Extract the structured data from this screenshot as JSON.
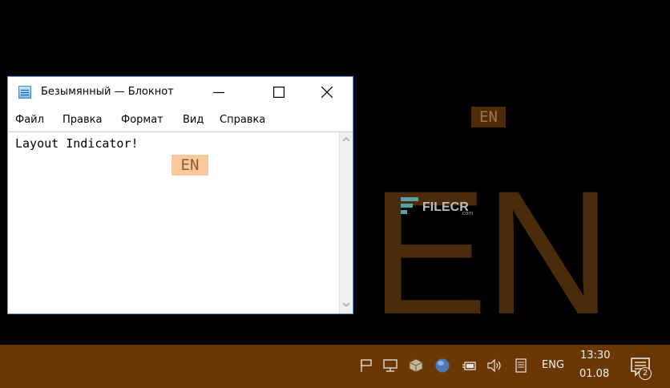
{
  "notepad": {
    "title": "Безымянный — Блокнот",
    "menu": [
      "Файл",
      "Правка",
      "Формат",
      "Вид",
      "Справка"
    ],
    "content": "Layout Indicator!"
  },
  "indicators": {
    "caret": "EN",
    "floating": "EN",
    "large": "EN"
  },
  "watermark": {
    "text": "FILECR",
    "sub": ".com"
  },
  "taskbar": {
    "language": "ENG",
    "time": "13:30",
    "date": "01.08",
    "notification_count": "2",
    "colors": {
      "taskbar": "#6b3705",
      "indicator": "#4e2c0a",
      "caret_indicator": "#f9c89b"
    }
  }
}
